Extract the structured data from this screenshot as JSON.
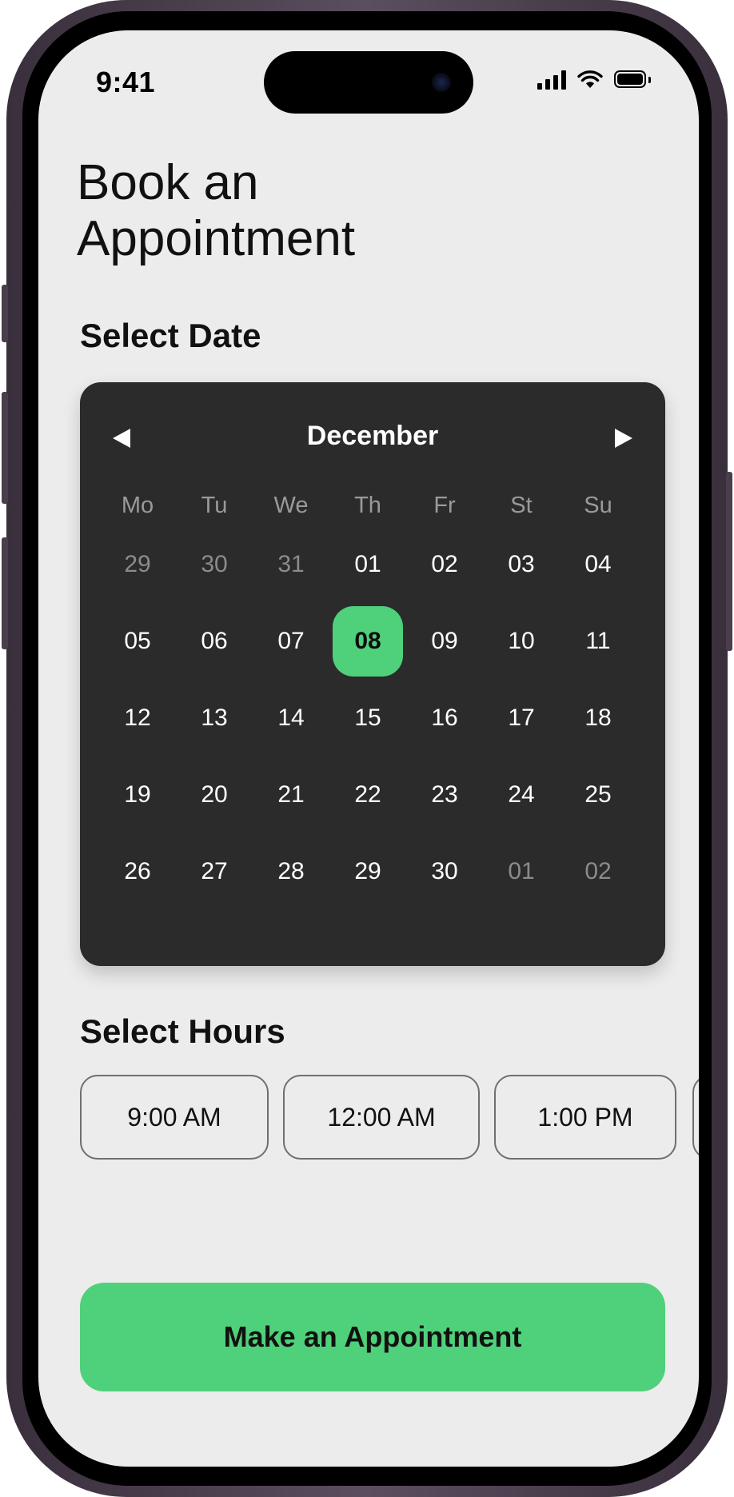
{
  "status_bar": {
    "time": "9:41"
  },
  "page": {
    "title_line1": "Book an",
    "title_line2": "Appointment"
  },
  "select_date": {
    "label": "Select Date",
    "month": "December",
    "weekdays": [
      "Mo",
      "Tu",
      "We",
      "Th",
      "Fr",
      "St",
      "Su"
    ],
    "weeks": [
      [
        {
          "d": "29",
          "muted": true
        },
        {
          "d": "30",
          "muted": true
        },
        {
          "d": "31",
          "muted": true
        },
        {
          "d": "01"
        },
        {
          "d": "02"
        },
        {
          "d": "03"
        },
        {
          "d": "04"
        }
      ],
      [
        {
          "d": "05"
        },
        {
          "d": "06"
        },
        {
          "d": "07"
        },
        {
          "d": "08",
          "selected": true
        },
        {
          "d": "09"
        },
        {
          "d": "10"
        },
        {
          "d": "11"
        }
      ],
      [
        {
          "d": "12"
        },
        {
          "d": "13"
        },
        {
          "d": "14"
        },
        {
          "d": "15"
        },
        {
          "d": "16"
        },
        {
          "d": "17"
        },
        {
          "d": "18"
        }
      ],
      [
        {
          "d": "19"
        },
        {
          "d": "20"
        },
        {
          "d": "21"
        },
        {
          "d": "22"
        },
        {
          "d": "23"
        },
        {
          "d": "24"
        },
        {
          "d": "25"
        }
      ],
      [
        {
          "d": "26"
        },
        {
          "d": "27"
        },
        {
          "d": "28"
        },
        {
          "d": "29"
        },
        {
          "d": "30"
        },
        {
          "d": "01",
          "muted": true
        },
        {
          "d": "02",
          "muted": true
        }
      ]
    ]
  },
  "select_hours": {
    "label": "Select Hours",
    "slots": [
      "9:00 AM",
      "12:00 AM",
      "1:00 PM",
      ""
    ]
  },
  "cta": {
    "label": "Make an Appointment"
  },
  "colors": {
    "accent": "#4fd07a",
    "calendar_bg": "#2b2b2b",
    "screen_bg": "#ececec"
  }
}
